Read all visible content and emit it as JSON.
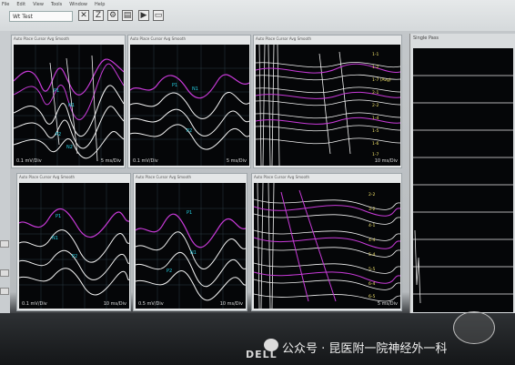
{
  "toolbar": {
    "menu": [
      "File",
      "Edit",
      "View",
      "Tools",
      "Window",
      "Help"
    ],
    "test_combo": "Wt Test"
  },
  "panels": [
    {
      "id": "p1",
      "title": "Auto Place Cursor  Avg  Smooth",
      "footer_left": "0.1 mV/Div",
      "footer_right": "5 ms/Div",
      "labels": [
        "P1",
        "N1",
        "P2",
        "N2"
      ]
    },
    {
      "id": "p2",
      "title": "Auto Place Cursor  Avg  Smooth",
      "footer_left": "0.1 mV/Div",
      "footer_right": "5 ms/Div",
      "labels": [
        "P1",
        "N1",
        "P2"
      ]
    },
    {
      "id": "p3",
      "title": "Auto Place Cursor  Avg  Smooth",
      "footer_left": "",
      "footer_right": "10 ms/Div",
      "labels": [
        "1-1",
        "1-2",
        "1-7 (Avg)",
        "2-1",
        "2-2",
        "1-4",
        "1-5",
        "1-6",
        "1-7"
      ]
    },
    {
      "id": "p4",
      "title": "Auto Place Cursor  Avg  Smooth",
      "footer_left": "0.1 mV/Div",
      "footer_right": "10 ms/Div",
      "labels": [
        "P1",
        "N1",
        "P2"
      ]
    },
    {
      "id": "p5",
      "title": "Auto Place Cursor  Avg  Smooth",
      "footer_left": "0.5 mV/Div",
      "footer_right": "10 ms/Div",
      "labels": [
        "P1",
        "N1",
        "P2"
      ]
    },
    {
      "id": "p6",
      "title": "Auto Place Cursor  Avg  Smooth",
      "footer_left": "",
      "footer_right": "5 ms/Div",
      "labels": [
        "2-2",
        "3-2",
        "4-1",
        "4-4",
        "5-4",
        "5-5",
        "6-4",
        "6-5"
      ]
    }
  ],
  "right_window": {
    "title": "Single Pass",
    "subtitle": "Single Pass"
  },
  "monitor_brand": "DELL",
  "watermark": "公众号 · 昆医附一院神经外一科",
  "colors": {
    "trace_white": "#f2f2f2",
    "trace_magenta": "#c83ad8",
    "trace_cyan": "#27d3e6",
    "plot_bg": "#050608"
  }
}
